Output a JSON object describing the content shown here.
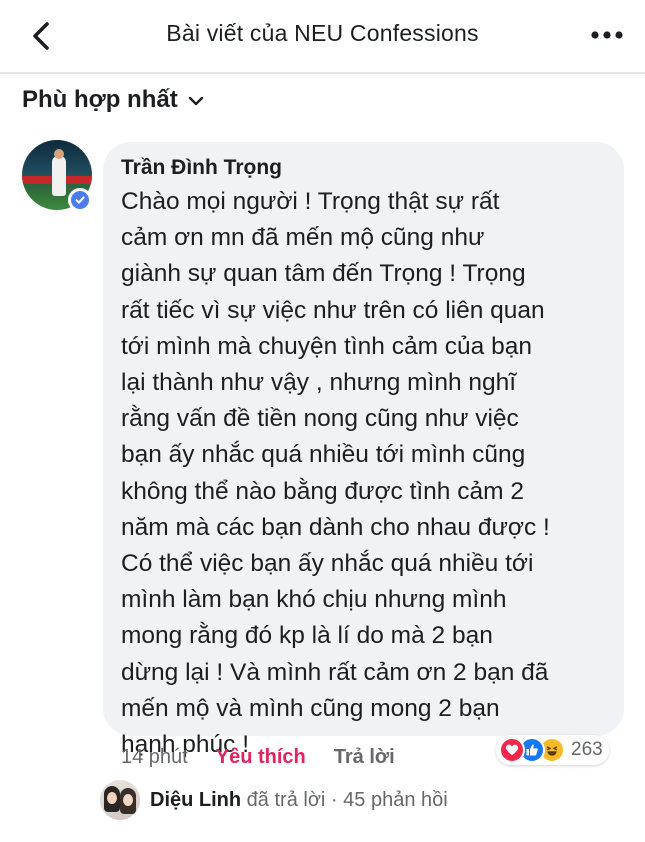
{
  "header": {
    "title": "Bài viết của NEU Confessions",
    "back_icon": "chevron-left-icon",
    "more_icon": "more-horizontal-icon"
  },
  "sort": {
    "label": "Phù hợp nhất",
    "icon": "chevron-down-icon"
  },
  "comment": {
    "author": "Trần Đình Trọng",
    "verified": true,
    "lines": [
      "Chào mọi người ! Trọng thật sự rất",
      "cảm ơn mn đã mến mộ cũng như",
      "giành sự quan tâm đến Trọng ! Trọng",
      "rất tiếc vì sự việc như trên có liên quan",
      "tới mình mà chuyện tình cảm của bạn",
      "lại thành như vậy , nhưng mình nghĩ",
      "rằng vấn đề tiền nong cũng như việc",
      "bạn ấy nhắc quá nhiều tới mình cũng",
      "không thể nào bằng được tình cảm 2",
      "năm mà các bạn dành cho nhau được !",
      "Có thể việc bạn ấy nhắc quá nhiều tới",
      "mình làm bạn khó chịu nhưng mình",
      "mong rằng đó kp là lí do mà 2 bạn",
      "dừng lại ! Và mình rất cảm ơn 2 bạn đã",
      "mến mộ và mình cũng mong 2 bạn",
      "hạnh phúc !"
    ],
    "time": "14 phút",
    "like_label": "Yêu thích",
    "reply_label": "Trả lời",
    "reactions": {
      "types": [
        "love",
        "like",
        "haha"
      ],
      "count": "263"
    }
  },
  "reply_preview": {
    "name": "Diệu Linh",
    "text": "đã trả lời · 45 phản hồi"
  },
  "colors": {
    "bubble": "#f0f2f5",
    "like_active": "#e0245e",
    "verified": "#4a7cf0",
    "secondary_text": "#65676b"
  }
}
